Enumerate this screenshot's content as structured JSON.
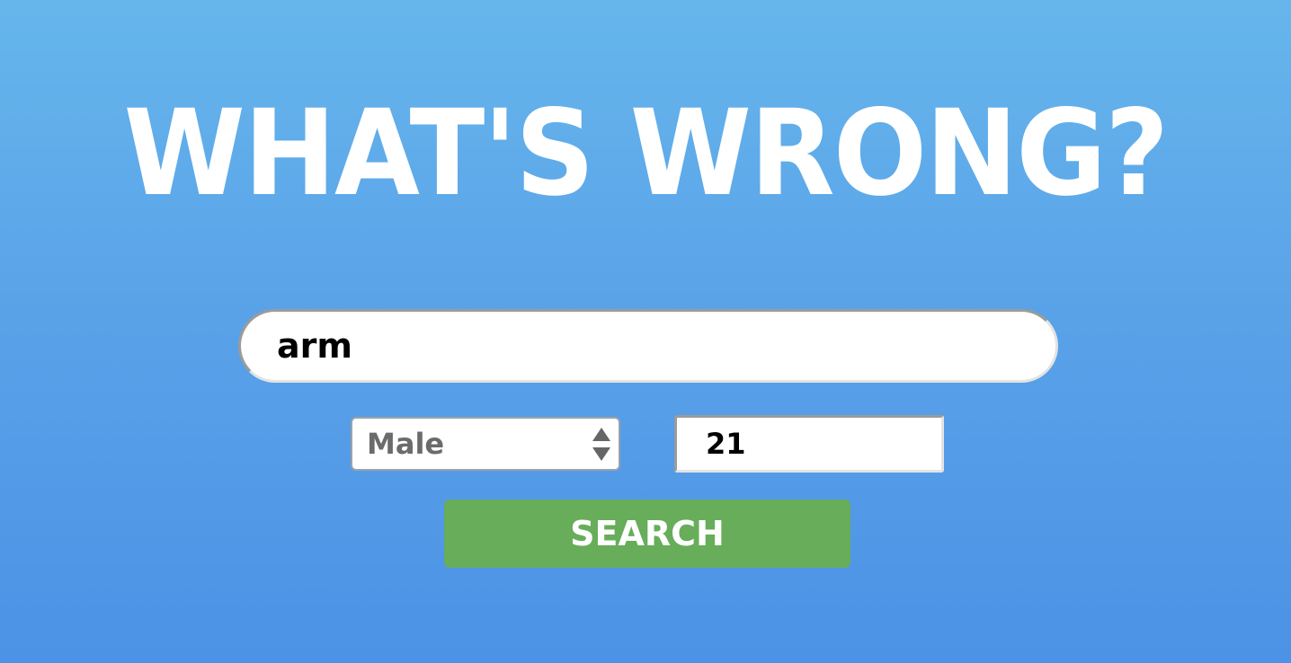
{
  "header": {
    "title": "WHAT'S WRONG?"
  },
  "form": {
    "symptom": {
      "value": "arm"
    },
    "gender": {
      "selected": "Male",
      "icon": "up-down-arrows-icon"
    },
    "age": {
      "value": "21"
    },
    "search_button": {
      "label": "SEARCH"
    }
  },
  "colors": {
    "background_top": "#66b6ec",
    "background_bottom": "#4c92e6",
    "button": "#67ad5a",
    "title": "#ffffff"
  }
}
